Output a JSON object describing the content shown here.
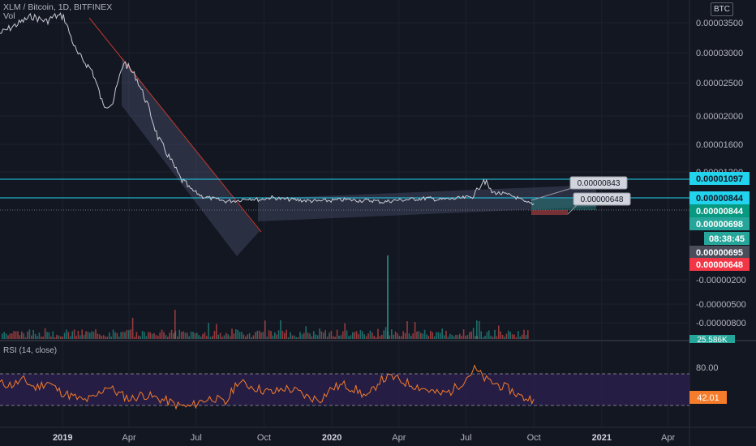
{
  "header": {
    "title": "XLM / Bitcoin, 1D, BITFINEX",
    "volume_label": "Vol"
  },
  "rsi_header": "RSI (14, close)",
  "currency_badge": "BTC",
  "colors": {
    "background": "#131722",
    "grid": "#1e2230",
    "price_line": "#c9ccd4",
    "channel_fill": "#4a4d6a",
    "trendline": "#c0392b",
    "hline": "#22d3ee",
    "rsi_line": "#f57c2a",
    "rsi_band": "#2a1f4a",
    "up_volume": "#26a69a",
    "down_volume": "#ef5350"
  },
  "chart_data": [
    {
      "type": "line",
      "name": "price",
      "title": "XLM / Bitcoin, 1D, BITFINEX",
      "x_ticks": [
        "2019",
        "Apr",
        "Jul",
        "Oct",
        "2020",
        "Apr",
        "Jul",
        "Oct",
        "2021",
        "Apr"
      ],
      "y_ticks": [
        "0.00003500",
        "0.00003000",
        "0.00002500",
        "0.00002000",
        "0.00001600",
        "0.00001200",
        "-0.00000200",
        "-0.00000500",
        "-0.00000800"
      ],
      "x_range": [
        "2018-10-08",
        "2021-04-30"
      ],
      "series": [
        {
          "x": [
            "2018-10-08",
            "2018-11-01",
            "2018-11-20",
            "2018-12-10",
            "2018-12-31",
            "2019-01-20",
            "2019-02-10",
            "2019-02-25",
            "2019-03-10",
            "2019-03-25",
            "2019-04-10",
            "2019-04-25",
            "2019-05-10",
            "2019-05-25",
            "2019-06-10",
            "2019-06-25",
            "2019-07-10",
            "2019-07-25",
            "2019-08-10",
            "2019-08-25",
            "2019-09-10",
            "2019-09-25",
            "2019-10-10",
            "2019-10-25",
            "2019-11-10",
            "2019-11-25",
            "2019-12-10",
            "2019-12-31",
            "2020-01-20",
            "2020-02-10",
            "2020-02-25",
            "2020-03-10",
            "2020-03-25",
            "2020-04-10",
            "2020-04-25",
            "2020-05-10",
            "2020-05-25",
            "2020-06-10",
            "2020-06-25",
            "2020-07-10",
            "2020-07-25",
            "2020-08-05",
            "2020-08-20",
            "2020-09-05",
            "2020-09-20",
            "2020-10-01"
          ],
          "values": [
            3.32e-05,
            3.48e-05,
            3.6e-05,
            3.52e-05,
            3.68e-05,
            3e-05,
            2.7e-05,
            2.15e-05,
            2.2e-05,
            2.85e-05,
            2.6e-05,
            2.2e-05,
            1.7e-05,
            1.42e-05,
            1.1e-05,
            9.5e-06,
            8.6e-06,
            8.3e-06,
            8e-06,
            8.1e-06,
            8.4e-06,
            8.2e-06,
            8.5e-06,
            8.3e-06,
            8.2e-06,
            8.1e-06,
            8e-06,
            8.1e-06,
            8.2e-06,
            8.1e-06,
            8.1e-06,
            7.9e-06,
            8.1e-06,
            8.2e-06,
            8.3e-06,
            8.4e-06,
            8.2e-06,
            8.3e-06,
            8.4e-06,
            8.6e-06,
            1.1e-05,
            9.2e-06,
            9e-06,
            8.6e-06,
            7.8e-06,
            7.7e-06
          ]
        }
      ],
      "annotations": [
        "0.00000843",
        "0.00000648"
      ],
      "price_labels": [
        {
          "text": "0.00001097",
          "color": "#22d3ee",
          "text_color": "#131722"
        },
        {
          "text": "0.00000844",
          "color": "#22d3ee",
          "text_color": "#131722"
        },
        {
          "text": "0.00000844",
          "color": "#089981",
          "text_color": "#ffffff"
        },
        {
          "text": "0.00000698",
          "color": "#26a69a",
          "text_color": "#ffffff"
        },
        {
          "text": "08:38:45",
          "color": "#26a69a",
          "text_color": "#ffffff"
        },
        {
          "text": "0.00000695",
          "color": "#4a4e5a",
          "text_color": "#ffffff"
        },
        {
          "text": "0.00000648",
          "color": "#f23645",
          "text_color": "#ffffff"
        }
      ],
      "volume_label": "25.586K"
    },
    {
      "type": "line",
      "name": "rsi",
      "title": "RSI (14, close)",
      "y_ticks": [
        "80.00"
      ],
      "levels": [
        70,
        30
      ],
      "current_value": "42.01",
      "values": [
        58,
        56,
        62,
        52,
        60,
        48,
        42,
        36,
        40,
        55,
        45,
        38,
        44,
        40,
        36,
        30,
        28,
        36,
        40,
        32,
        60,
        55,
        50,
        46,
        52,
        48,
        40,
        38,
        52,
        56,
        50,
        40,
        62,
        66,
        60,
        55,
        50,
        44,
        48,
        60,
        76,
        62,
        56,
        50,
        40,
        38
      ]
    }
  ]
}
